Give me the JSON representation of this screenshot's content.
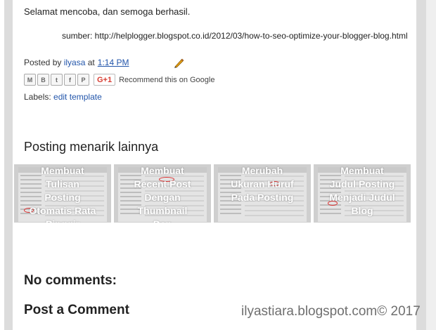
{
  "post": {
    "closing_text": "Selamat mencoba, dan semoga berhasil.",
    "source_text": "sumber: http://helplogger.blogspot.co.id/2012/03/how-to-seo-optimize-your-blogger-blog.html"
  },
  "byline": {
    "prefix": "Posted by",
    "author": "ilyasa",
    "at": "at",
    "time": "1:14 PM"
  },
  "share": {
    "buttons": [
      {
        "icon": "email-icon",
        "glyph": "M"
      },
      {
        "icon": "blogger-icon",
        "glyph": "B"
      },
      {
        "icon": "twitter-icon",
        "glyph": "t"
      },
      {
        "icon": "facebook-icon",
        "glyph": "f"
      },
      {
        "icon": "pinterest-icon",
        "glyph": "P"
      }
    ],
    "gplus_label": "G+1",
    "recommend_text": "Recommend this on Google"
  },
  "labels": {
    "prefix": "Labels:",
    "value": "edit template"
  },
  "related": {
    "title": "Posting menarik lainnya",
    "items": [
      {
        "title": "Membuat Tulisan Posting Otomatis Rata Pinggir"
      },
      {
        "title": "Membuat Recent Post Dengan Thumbnail Dan"
      },
      {
        "title": "Merubah Ukuran Huruf Pada Posting"
      },
      {
        "title": "Membuat Judul Posting Menjadi Judul Blog"
      }
    ]
  },
  "comments": {
    "none_label": "No comments:",
    "post_label": "Post a Comment"
  },
  "watermark": "ilyastiara.blogspot.com© 2017",
  "colors": {
    "link": "#2255aa",
    "gplus": "#d73d32",
    "gutter": "#dcdcdc"
  }
}
